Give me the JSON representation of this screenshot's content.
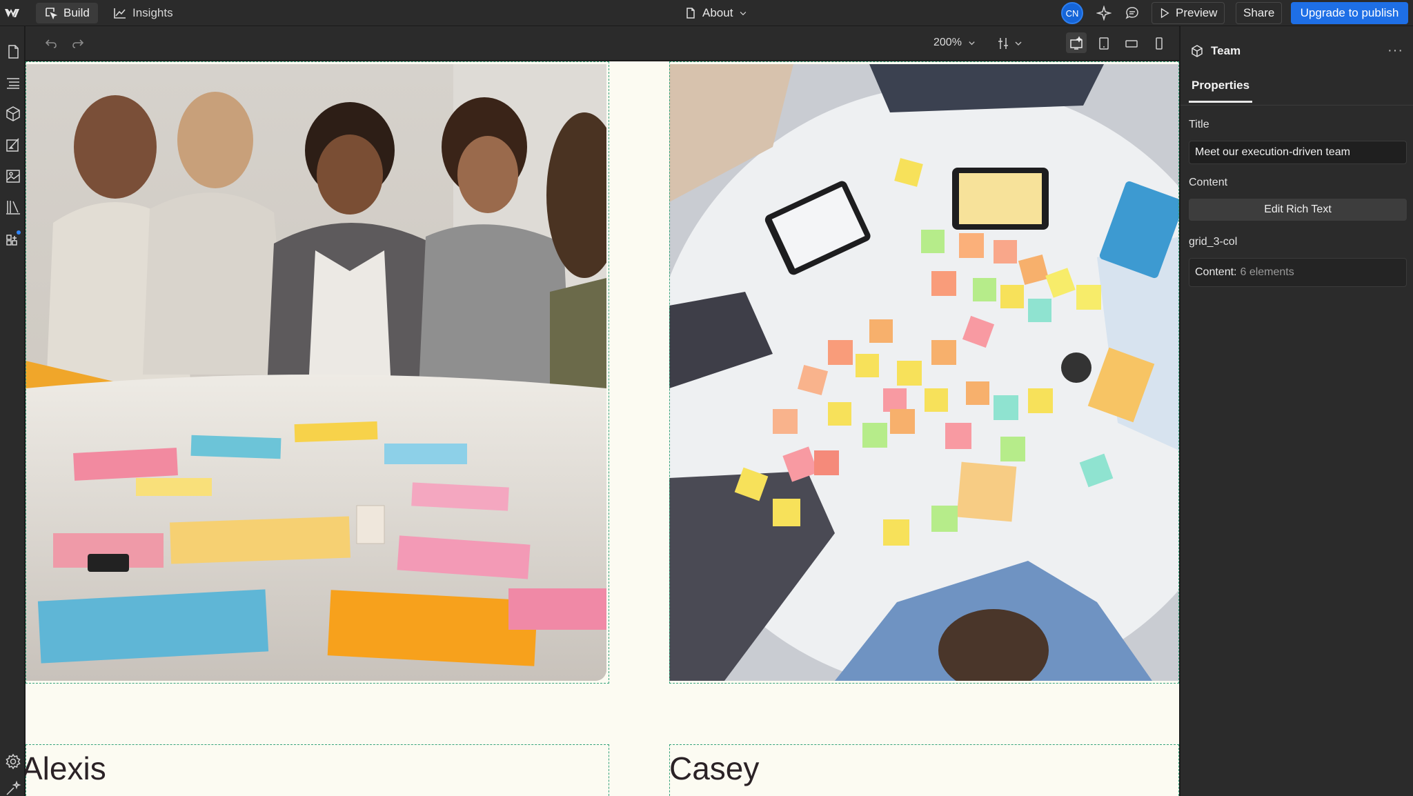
{
  "topbar": {
    "logo_icon": "webflow-logo-icon",
    "tabs": [
      {
        "label": "Build",
        "icon": "cursor-select-icon",
        "active": true
      },
      {
        "label": "Insights",
        "icon": "line-chart-icon",
        "active": false
      }
    ],
    "page_name": "About",
    "avatar_initials": "CN",
    "preview_label": "Preview",
    "share_label": "Share",
    "publish_label": "Upgrade to publish",
    "accent": "#1e6fe6"
  },
  "canvas_toolbar": {
    "zoom": "200%"
  },
  "canvas": {
    "background": "#fcfbf2",
    "cards": [
      {
        "name": "Alexis",
        "image": "team-brainstorm-table-photo"
      },
      {
        "name": "Casey",
        "image": "team-overhead-sticky-notes-photo"
      }
    ]
  },
  "panel": {
    "component_name": "Team",
    "tab": "Properties",
    "title_label": "Title",
    "title_value": "Meet our execution-driven team",
    "content_label": "Content",
    "edit_rich_text_label": "Edit Rich Text",
    "slot_label": "grid_3-col",
    "slot_content_key": "Content:",
    "slot_content_value": "6 elements"
  }
}
